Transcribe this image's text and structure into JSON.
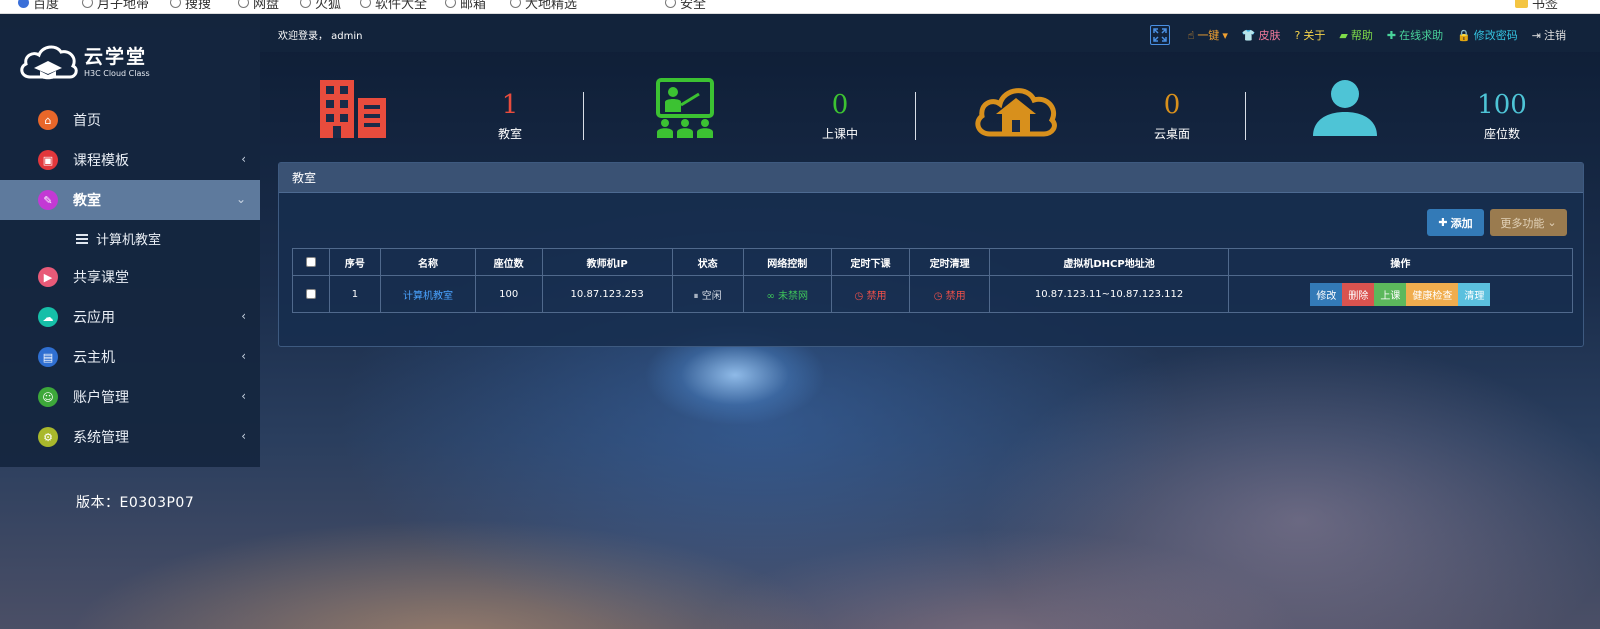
{
  "bookmarks": [
    "百度",
    "月子地带",
    "搜搜",
    "网盘",
    "火狐",
    "软件大全",
    "邮箱",
    "大地精选",
    "安全",
    "书签"
  ],
  "sidebar": {
    "logo_title": "云学堂",
    "logo_sub": "H3C Cloud Class",
    "items": [
      {
        "label": "首页",
        "color": "#e8672a",
        "icon": "home-icon"
      },
      {
        "label": "课程模板",
        "color": "#e2373c",
        "icon": "template-icon"
      },
      {
        "label": "教室",
        "color": "#c339d4",
        "icon": "classroom-icon"
      },
      {
        "label": "共享课堂",
        "color": "#e85a78",
        "icon": "play-icon"
      },
      {
        "label": "云应用",
        "color": "#16bfa8",
        "icon": "cloud-icon"
      },
      {
        "label": "云主机",
        "color": "#2f6fd1",
        "icon": "server-icon"
      },
      {
        "label": "账户管理",
        "color": "#3da83a",
        "icon": "user-icon"
      },
      {
        "label": "系统管理",
        "color": "#a9b82c",
        "icon": "gear-icon"
      }
    ],
    "subitem": "计算机教室",
    "version": "版本：E0303P07"
  },
  "topbar": {
    "welcome": "欢迎登录， admin",
    "links": [
      {
        "label": "一键",
        "color": "#f0a030"
      },
      {
        "label": "皮肤",
        "color": "#f07a9a"
      },
      {
        "label": "关于",
        "color": "#f3d14a"
      },
      {
        "label": "帮助",
        "color": "#7fdc4a"
      },
      {
        "label": "在线求助",
        "color": "#49d39b"
      },
      {
        "label": "修改密码",
        "color": "#34c3e0"
      },
      {
        "label": "注销",
        "color": "#e0e0e0"
      }
    ]
  },
  "stats": [
    {
      "value": "1",
      "label": "教室",
      "color": "#e84c3d"
    },
    {
      "value": "0",
      "label": "上课中",
      "color": "#3cc232"
    },
    {
      "value": "0",
      "label": "云桌面",
      "color": "#d8901c"
    },
    {
      "value": "100",
      "label": "座位数",
      "color": "#4ec4d6"
    }
  ],
  "panel": {
    "title": "教室",
    "add_label": "添加",
    "more_label": "更多功能",
    "headers": [
      "序号",
      "名称",
      "座位数",
      "教师机IP",
      "状态",
      "网络控制",
      "定时下课",
      "定时清理",
      "虚拟机DHCP地址池",
      "操作"
    ],
    "row": {
      "index": "1",
      "name": "计算机教室",
      "seats": "100",
      "teacher_ip": "10.87.123.253",
      "status": "空闲",
      "network": "未禁网",
      "timed_end": "禁用",
      "timed_clean": "禁用",
      "dhcp_pool": "10.87.123.11~10.87.123.112"
    },
    "ops": [
      {
        "label": "修改",
        "color": "#337ab7"
      },
      {
        "label": "删除",
        "color": "#d9534f"
      },
      {
        "label": "上课",
        "color": "#5cb85c"
      },
      {
        "label": "健康检查",
        "color": "#f0ad4e"
      },
      {
        "label": "清理",
        "color": "#5bc0de"
      }
    ]
  }
}
